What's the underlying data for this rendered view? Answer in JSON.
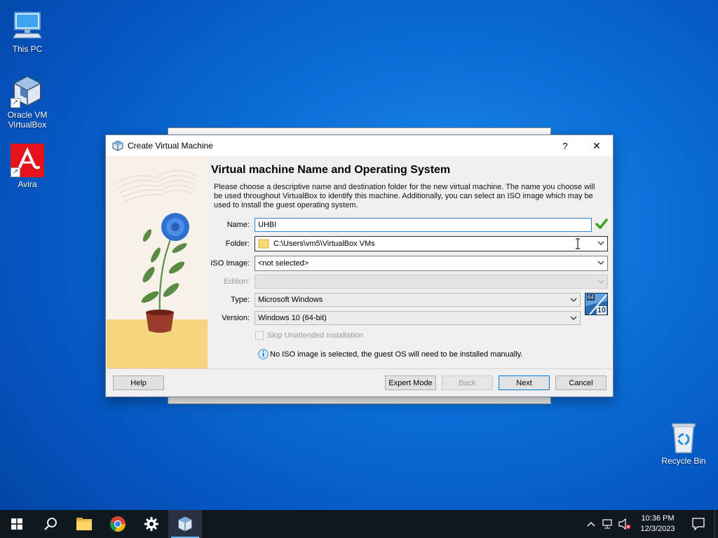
{
  "desktop": {
    "icons": [
      {
        "label": "This PC"
      },
      {
        "label": "Oracle VM VirtualBox"
      },
      {
        "label": "Avira"
      },
      {
        "label": "Recycle Bin"
      }
    ]
  },
  "dialog": {
    "title": "Create Virtual Machine",
    "help_glyph": "?",
    "close_glyph": "✕",
    "heading": "Virtual machine Name and Operating System",
    "description": "Please choose a descriptive name and destination folder for the new virtual machine. The name you choose will be used throughout VirtualBox to identify this machine. Additionally, you can select an ISO image which may be used to install the guest operating system.",
    "form": {
      "name_label": "Name:",
      "name_value": "UHBI",
      "folder_label": "Folder:",
      "folder_value": "C:\\Users\\vm5\\VirtualBox VMs",
      "iso_label": "ISO Image:",
      "iso_value": "<not selected>",
      "edition_label": "Edition:",
      "edition_value": "",
      "type_label": "Type:",
      "type_value": "Microsoft Windows",
      "version_label": "Version:",
      "version_value": "Windows 10 (64-bit)",
      "skip_unattended_label": "Skip Unattended Installation",
      "info_message": "No ISO image is selected, the guest OS will need to be installed manually.",
      "os_badge_top": "64",
      "os_badge_num": "10"
    },
    "buttons": {
      "help": "Help",
      "expert_mode": "Expert Mode",
      "back": "Back",
      "next": "Next",
      "cancel": "Cancel"
    }
  },
  "taskbar": {
    "apps": [
      "start-icon",
      "search-icon",
      "file-explorer-icon",
      "chrome-icon",
      "settings-icon",
      "virtualbox-icon"
    ],
    "clock_time": "10:36 PM",
    "clock_date": "12/3/2023"
  },
  "colors": {
    "accent": "#0078d7",
    "valid_check": "#3aa317"
  }
}
